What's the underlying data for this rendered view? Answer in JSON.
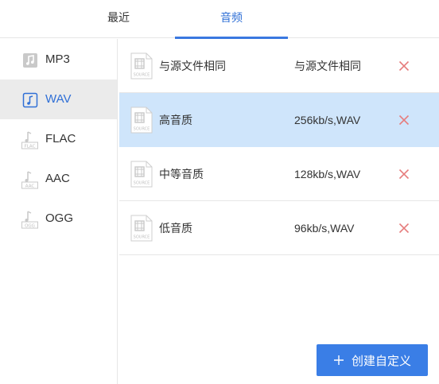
{
  "tabs": {
    "recent": "最近",
    "audio": "音频"
  },
  "sidebar": {
    "items": [
      {
        "label": "MP3",
        "icon": "music-note-icon",
        "active": false
      },
      {
        "label": "WAV",
        "icon": "music-note-icon",
        "active": true
      },
      {
        "label": "FLAC",
        "icon": "flac-file-icon",
        "active": false
      },
      {
        "label": "AAC",
        "icon": "aac-file-icon",
        "active": false
      },
      {
        "label": "OGG",
        "icon": "ogg-file-icon",
        "active": false
      }
    ]
  },
  "presets": {
    "rows": [
      {
        "name": "与源文件相同",
        "spec": "与源文件相同",
        "selected": false
      },
      {
        "name": "高音质",
        "spec": "256kb/s,WAV",
        "selected": true
      },
      {
        "name": "中等音质",
        "spec": "128kb/s,WAV",
        "selected": false
      },
      {
        "name": "低音质",
        "spec": "96kb/s,WAV",
        "selected": false
      }
    ],
    "file_icon_label": "SOURCE"
  },
  "create_button": {
    "label": "创建自定义"
  },
  "colors": {
    "accent": "#3a7ee6",
    "selected_row": "#cfe5fb",
    "delete": "#e67d7d"
  }
}
